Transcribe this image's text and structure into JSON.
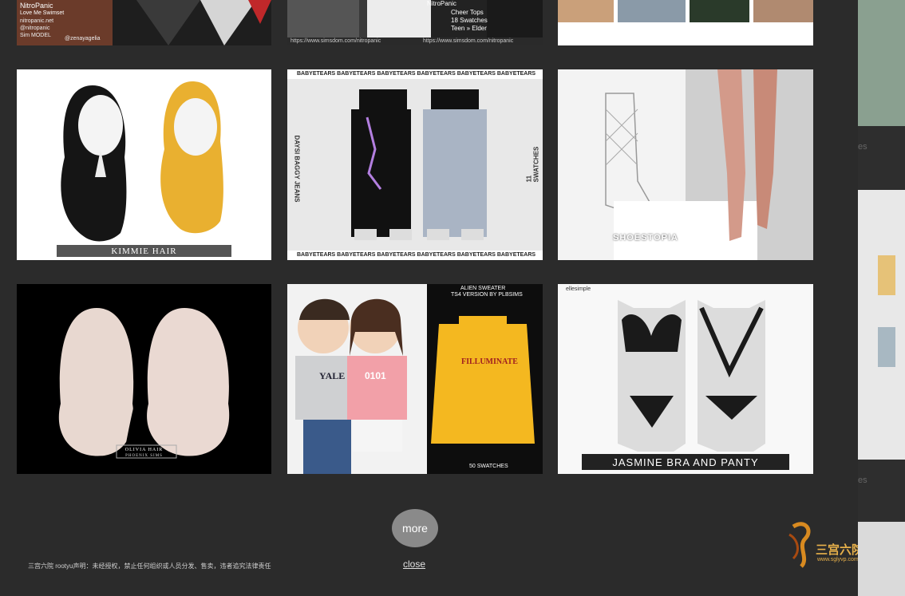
{
  "top_row": {
    "tile1": {
      "lines": [
        "NitroPanic",
        "Love Me Swimset",
        "nitropanic.net",
        "@nitropanic",
        "Sim MODEL",
        "@zenayagelia"
      ]
    },
    "tile2": {
      "lines": [
        "NitroPanic",
        "Cheer Tops",
        "18 Swatches",
        "Teen » Elder"
      ],
      "url": "https://www.simsdom.com/nitropanic"
    }
  },
  "tiles": [
    {
      "caption": "KIMMIE HAIR"
    },
    {
      "top_banner": "BABYETEARS BABYETEARS BABYETEARS BABYETEARS BABYETEARS BABYETEARS",
      "side_left": "DAYSI BAGGY JEANS",
      "side_right": "11 SWATCHES",
      "bottom_banner": "BABYETEARS BABYETEARS BABYETEARS BABYETEARS BABYETEARS BABYETEARS"
    },
    {
      "caption": "SHOESTOPIA"
    },
    {
      "caption": "OLIVIA HAIR",
      "sub": "PHOENIX SIMS"
    },
    {
      "title": "ALIEN SWEATER",
      "sub": "TS4 VERSION BY PLBSIMS",
      "shirt_text_left": "YALE",
      "shirt_text_right": "0101",
      "sweater_text": "FILLUMINATE",
      "swatches": "50 SWATCHES"
    },
    {
      "tag": "ellesimple",
      "caption": "JASMINE BRA AND PANTY"
    }
  ],
  "side": {
    "label1": "es",
    "label2": "es"
  },
  "more_label": "more",
  "close_label": "close",
  "disclaimer": "三宫六院 rootyu声明：未经授权，禁止任何组织或人员分发、售卖，违者追究法律责任",
  "logo": {
    "text": "三宫六院",
    "url": "www.sglyvp.com"
  },
  "colors": {
    "background": "#2b2b2b",
    "button": "#8a8a8a",
    "link": "#e0e0e0"
  }
}
